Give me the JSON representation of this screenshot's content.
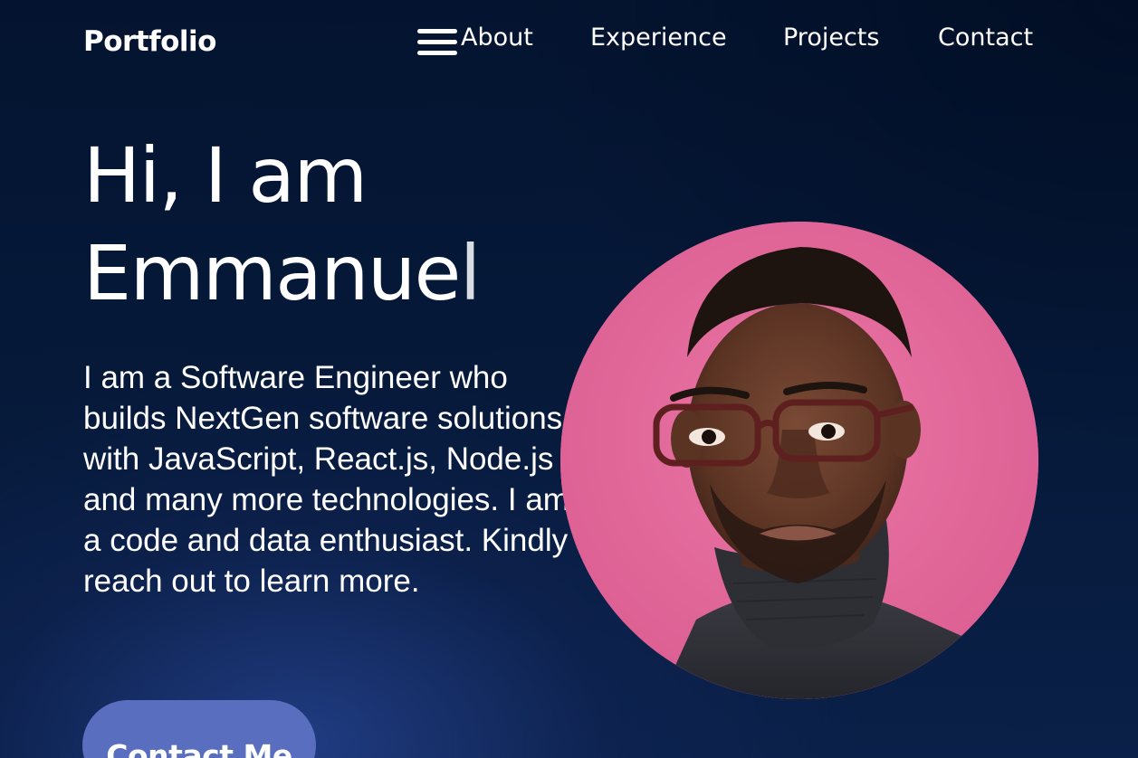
{
  "brand": {
    "logo_text": "Portfolio"
  },
  "nav": {
    "menu_icon": "hamburger-menu-icon",
    "links": [
      {
        "label": "About"
      },
      {
        "label": "Experience"
      },
      {
        "label": "Projects"
      },
      {
        "label": "Contact"
      }
    ]
  },
  "hero": {
    "title_line1": "Hi, I am",
    "title_line2_main": "Emmanue",
    "title_line2_tail": "l",
    "description": "I am a Software Engineer who builds NextGen software solutions with JavaScript, React.js, Node.js and many more technologies. I am a code and data enthusiast. Kindly reach out to learn more.",
    "cta_label": "Contact Me"
  },
  "colors": {
    "background": "#041430",
    "accent_button": "#5a6ec0",
    "avatar_background": "#e0679a",
    "text": "#ffffff"
  }
}
